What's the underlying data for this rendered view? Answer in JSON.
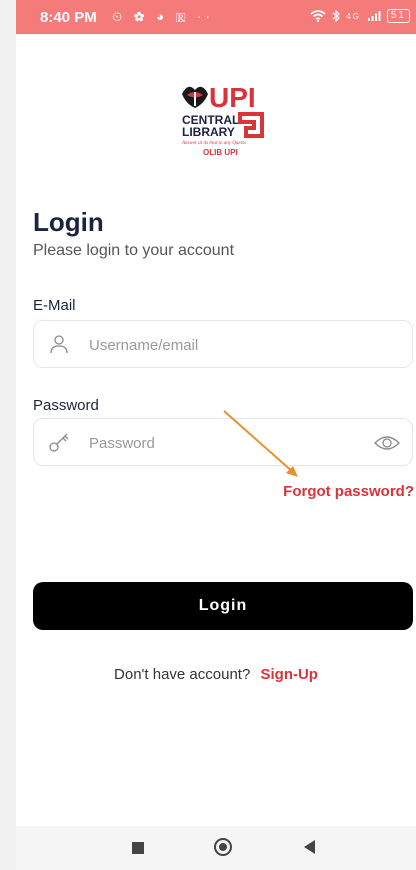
{
  "status_bar": {
    "time": "8:40 PM",
    "icons_left": "⏲ ✿ ◕ 🅁 ··",
    "battery": "51",
    "network": "4G"
  },
  "logo": {
    "brand": "UPI",
    "line1": "CENTRAL",
    "line2": "LIBRARY",
    "tagline": "Answer at its best to any Quests",
    "name": "OLIB UPI"
  },
  "header": {
    "title": "Login",
    "subtitle": "Please login to your account"
  },
  "email": {
    "label": "E-Mail",
    "placeholder": "Username/email"
  },
  "password": {
    "label": "Password",
    "placeholder": "Password"
  },
  "forgot": "Forgot password?",
  "login_button": "Login",
  "signup": {
    "prompt": "Don't have account?",
    "link": "Sign-Up"
  },
  "colors": {
    "accent": "#d9343a",
    "status_bar": "#f57b7b",
    "button": "#000000",
    "annotation_arrow": "#e8902a"
  }
}
